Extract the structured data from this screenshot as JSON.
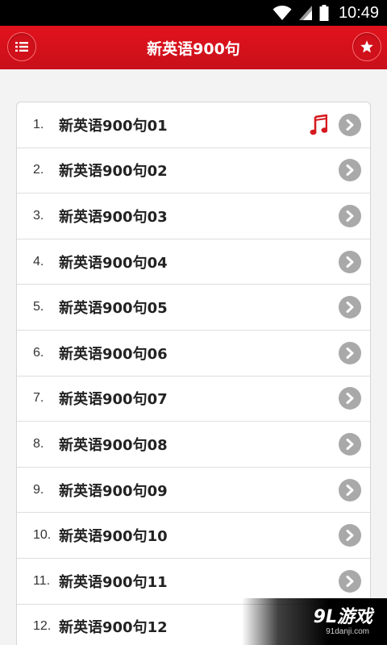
{
  "status_bar": {
    "time": "10:49",
    "icons": [
      "wifi-icon",
      "signal-icon",
      "battery-icon"
    ]
  },
  "app_bar": {
    "title": "新英语900句",
    "left_icon": "list-menu-icon",
    "right_icon": "star-icon",
    "color": "#d7141d"
  },
  "lessons": [
    {
      "number": "1.",
      "title": "新英语900句01",
      "playing": true
    },
    {
      "number": "2.",
      "title": "新英语900句02",
      "playing": false
    },
    {
      "number": "3.",
      "title": "新英语900句03",
      "playing": false
    },
    {
      "number": "4.",
      "title": "新英语900句04",
      "playing": false
    },
    {
      "number": "5.",
      "title": "新英语900句05",
      "playing": false
    },
    {
      "number": "6.",
      "title": "新英语900句06",
      "playing": false
    },
    {
      "number": "7.",
      "title": "新英语900句07",
      "playing": false
    },
    {
      "number": "8.",
      "title": "新英语900句08",
      "playing": false
    },
    {
      "number": "9.",
      "title": "新英语900句09",
      "playing": false
    },
    {
      "number": "10.",
      "title": "新英语900句10",
      "playing": false
    },
    {
      "number": "11.",
      "title": "新英语900句11",
      "playing": false
    },
    {
      "number": "12.",
      "title": "新英语900句12",
      "playing": false
    }
  ],
  "watermark": {
    "main": "9L游戏",
    "sub": "91danji.com"
  }
}
